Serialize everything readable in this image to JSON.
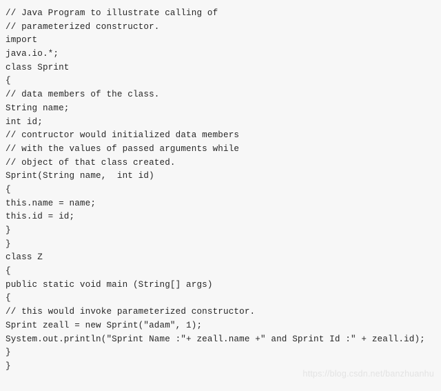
{
  "document": {
    "type": "code-listing",
    "language": "java",
    "background_color": "#f7f7f7",
    "text_color": "#262626",
    "lines": [
      "// Java Program to illustrate calling of",
      "// parameterized constructor.",
      "import",
      "java.io.*;",
      "class Sprint",
      "{",
      "// data members of the class.",
      "String name;",
      "int id;",
      "// contructor would initialized data members",
      "// with the values of passed arguments while",
      "// object of that class created.",
      "Sprint(String name,  int id)",
      "{",
      "this.name = name;",
      "this.id = id;",
      "}",
      "}",
      "class Z",
      "{",
      "public static void main (String[] args)",
      "{",
      "// this would invoke parameterized constructor.",
      "Sprint zeall = new Sprint(\"adam\", 1);",
      "System.out.println(\"Sprint Name :\"+ zeall.name +\" and Sprint Id :\" + zeall.id);",
      "}",
      "}"
    ]
  },
  "watermark": {
    "text": "https://blog.csdn.net/banzhuanhu",
    "color": "#e3e3e3"
  }
}
